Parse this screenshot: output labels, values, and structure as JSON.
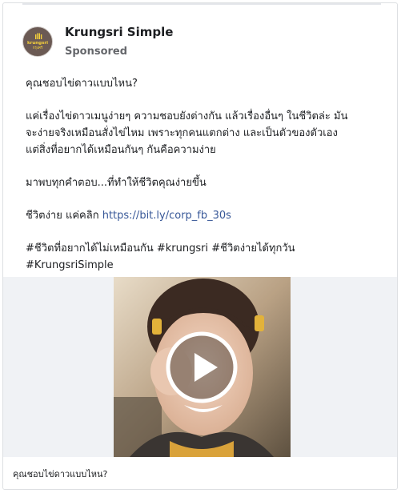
{
  "post": {
    "page_name": "Krungsri Simple",
    "sponsored_label": "Sponsored",
    "avatar": {
      "logo_text": "krungsri",
      "logo_subtext": "กรุงศรี",
      "background_color": "#6b5a54",
      "logo_color": "#f7d23a",
      "icon": "krungsri-logo-icon"
    },
    "text": {
      "line1": "คุณชอบไข่ดาวแบบไหน?",
      "line2": "แค่เรื่องไข่ดาวเมนูง่ายๆ ความชอบยังต่างกัน แล้วเรื่องอื่นๆ ในชีวิตล่ะ มัน",
      "line3": "จะง่ายจริงเหมือนสั่งไข่ไหม เพราะทุกคนแตกต่าง และเป็นตัวของตัวเอง",
      "line4": "แต่สิ่งที่อยากได้เหมือนกันๆ กันคือความง่าย",
      "line5": "มาพบทุกคำตอบ...ที่ทำให้ชีวิตคุณง่ายขึ้น",
      "line6_prefix": "ชีวิตง่าย แค่คลิก ",
      "line6_link": "https://bit.ly/corp_fb_30s",
      "hashtags_line1": "#ชีวิตที่อยากได้ไม่เหมือนกัน  #krungsri  #ชีวิตง่ายได้ทุกวัน",
      "hashtags_line2": "#KrungsriSimple"
    },
    "media": {
      "type": "video",
      "play_icon": "play-icon",
      "caption": "คุณชอบไข่ดาวแบบไหน?"
    },
    "colors": {
      "link": "#385898",
      "secondary_text": "#65676b",
      "primary_text": "#1c1e21"
    }
  }
}
